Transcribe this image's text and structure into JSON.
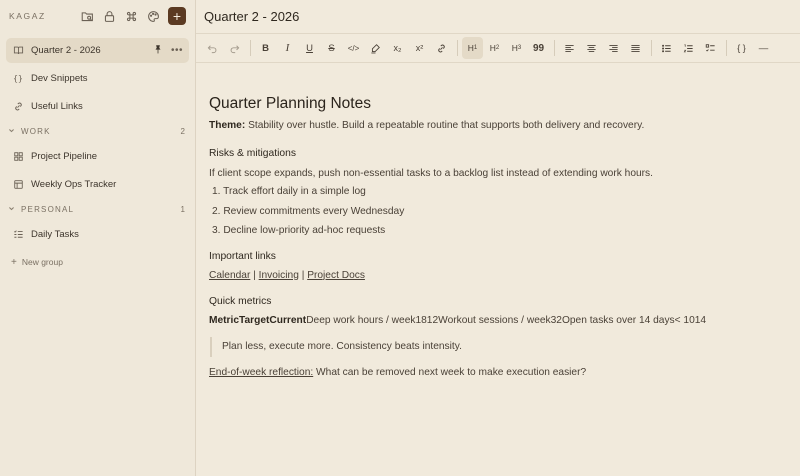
{
  "sidebar": {
    "brand": "KAGAZ",
    "tools": [
      "folder-search-icon",
      "lock-icon",
      "command-icon",
      "palette-icon"
    ],
    "add_label": "+",
    "pages": [
      {
        "label": "Quarter 2 - 2026",
        "icon": "book-icon",
        "active": true
      },
      {
        "label": "Dev Snippets",
        "icon": "braces-icon"
      },
      {
        "label": "Useful Links",
        "icon": "link-icon"
      }
    ],
    "groups": [
      {
        "title": "WORK",
        "count": "2",
        "items": [
          {
            "label": "Project Pipeline",
            "icon": "grid-icon"
          },
          {
            "label": "Weekly Ops Tracker",
            "icon": "table-icon"
          }
        ]
      },
      {
        "title": "PERSONAL",
        "count": "1",
        "items": [
          {
            "label": "Daily Tasks",
            "icon": "checklist-icon"
          }
        ]
      }
    ],
    "new_group_label": "New group"
  },
  "document": {
    "title": "Quarter 2 - 2026",
    "heading": "Quarter Planning Notes",
    "theme_label": "Theme:",
    "theme_text": " Stability over hustle. Build a repeatable routine that supports both delivery and recovery.",
    "risks_heading": "Risks & mitigations",
    "risks_text": "If client scope expands, push non-essential tasks to a backlog list instead of extending work hours.",
    "list": [
      "Track effort daily in a simple log",
      "Review commitments every Wednesday",
      "Decline low-priority ad-hoc requests"
    ],
    "links_heading": "Important links",
    "links": [
      "Calendar",
      "Invoicing",
      "Project Docs"
    ],
    "links_sep": " | ",
    "metrics_heading": "Quick metrics",
    "metrics_header": "MetricTargetCurrent",
    "metrics_rows": "Deep work hours / week1812Workout sessions / week32Open tasks over 14 days< 1014",
    "quote": "Plan less, execute more. Consistency beats intensity.",
    "reflection_label": "End-of-week reflection:",
    "reflection_text": " What can be removed next week to make execution easier?"
  },
  "toolbar": {
    "h1": "H",
    "h2": "H",
    "h3": "H",
    "sub1": "1",
    "sub2": "2",
    "sub3": "3",
    "bold": "B",
    "italic": "I",
    "underline": "U",
    "strike": "S",
    "code": "</>",
    "subscript": "x₂",
    "superscript": "x²",
    "quote": "99",
    "code_block": "{ }",
    "hr": "—"
  },
  "colors": {
    "background": "#f1eadc",
    "accent": "#5b3a22",
    "active": "#e4dac7"
  }
}
